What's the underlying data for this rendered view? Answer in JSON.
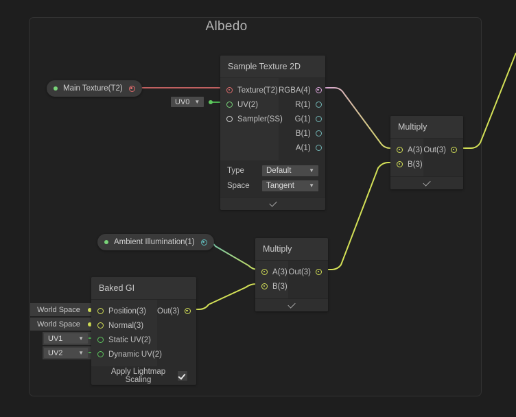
{
  "group": {
    "title": "Albedo"
  },
  "nodes": {
    "main_texture": {
      "label": "Main Texture(T2)",
      "dot_color": "#79d479",
      "port_color": "#e06c6c"
    },
    "ambient_illumination": {
      "label": "Ambient Illumination(1)",
      "dot_color": "#79d479",
      "port_color": "#5fb8b8"
    },
    "uv0_chip": {
      "value": "UV0",
      "caret": "▼",
      "edge_dot_color": "#5ec75e"
    },
    "sample_texture_2d": {
      "title": "Sample Texture 2D",
      "inputs": [
        {
          "label": "Texture(T2)",
          "slot": "filled",
          "color": "#e06c6c"
        },
        {
          "label": "UV(2)",
          "slot": "hollow",
          "color": "#79d479"
        },
        {
          "label": "Sampler(SS)",
          "slot": "hollow",
          "color": "#d8d8d8"
        }
      ],
      "outputs": [
        {
          "label": "RGBA(4)",
          "slot": "filled",
          "color": "#d9a3d9"
        },
        {
          "label": "R(1)",
          "slot": "hollow",
          "color": "#73b8b8"
        },
        {
          "label": "G(1)",
          "slot": "hollow",
          "color": "#73b8b8"
        },
        {
          "label": "B(1)",
          "slot": "hollow",
          "color": "#73b8b8"
        },
        {
          "label": "A(1)",
          "slot": "hollow",
          "color": "#73b8b8"
        }
      ],
      "settings": [
        {
          "name": "Type",
          "value": "Default",
          "caret": "▼"
        },
        {
          "name": "Space",
          "value": "Tangent",
          "caret": "▼"
        }
      ]
    },
    "multiply_top": {
      "title": "Multiply",
      "inputs": [
        {
          "label": "A(3)",
          "slot": "filled",
          "color": "#d4e157"
        },
        {
          "label": "B(3)",
          "slot": "filled",
          "color": "#d4e157"
        }
      ],
      "outputs": [
        {
          "label": "Out(3)",
          "slot": "filled",
          "color": "#d4e157"
        }
      ]
    },
    "multiply_bottom": {
      "title": "Multiply",
      "inputs": [
        {
          "label": "A(3)",
          "slot": "filled",
          "color": "#d4e157"
        },
        {
          "label": "B(3)",
          "slot": "filled",
          "color": "#d4e157"
        }
      ],
      "outputs": [
        {
          "label": "Out(3)",
          "slot": "filled",
          "color": "#d4e157"
        }
      ]
    },
    "baked_gi": {
      "title": "Baked GI",
      "inputs": [
        {
          "label": "Position(3)",
          "slot": "hollow",
          "color": "#d4e157"
        },
        {
          "label": "Normal(3)",
          "slot": "hollow",
          "color": "#d4e157"
        },
        {
          "label": "Static UV(2)",
          "slot": "hollow",
          "color": "#5ec75e"
        },
        {
          "label": "Dynamic UV(2)",
          "slot": "hollow",
          "color": "#5ec75e"
        }
      ],
      "outputs": [
        {
          "label": "Out(3)",
          "slot": "filled",
          "color": "#d4e157"
        }
      ],
      "input_chips": [
        {
          "value": "World Space",
          "style": "plain",
          "caret": "",
          "dot_color": "#d4e157"
        },
        {
          "value": "World Space",
          "style": "plain",
          "caret": "",
          "dot_color": "#d4e157"
        },
        {
          "value": "UV1",
          "style": "boxed",
          "caret": "▼",
          "dot_color": "#5ec75e"
        },
        {
          "value": "UV2",
          "style": "boxed",
          "caret": "▼",
          "dot_color": "#5ec75e"
        }
      ],
      "footer": {
        "label": "Apply Lightmap Scaling",
        "checked": true
      }
    }
  },
  "colors": {
    "canvas_bg": "#1e1e1e",
    "group_bg": "#212121",
    "group_border": "#323232",
    "node_body": "#2b2b2b",
    "node_header": "#323232",
    "wire_texture": "#c06060",
    "wire_uv": "#4caf50",
    "wire_rgba": "#d9a3d9",
    "wire_vector": "#d4e157",
    "wire_ambient": "#5fc4c4"
  }
}
